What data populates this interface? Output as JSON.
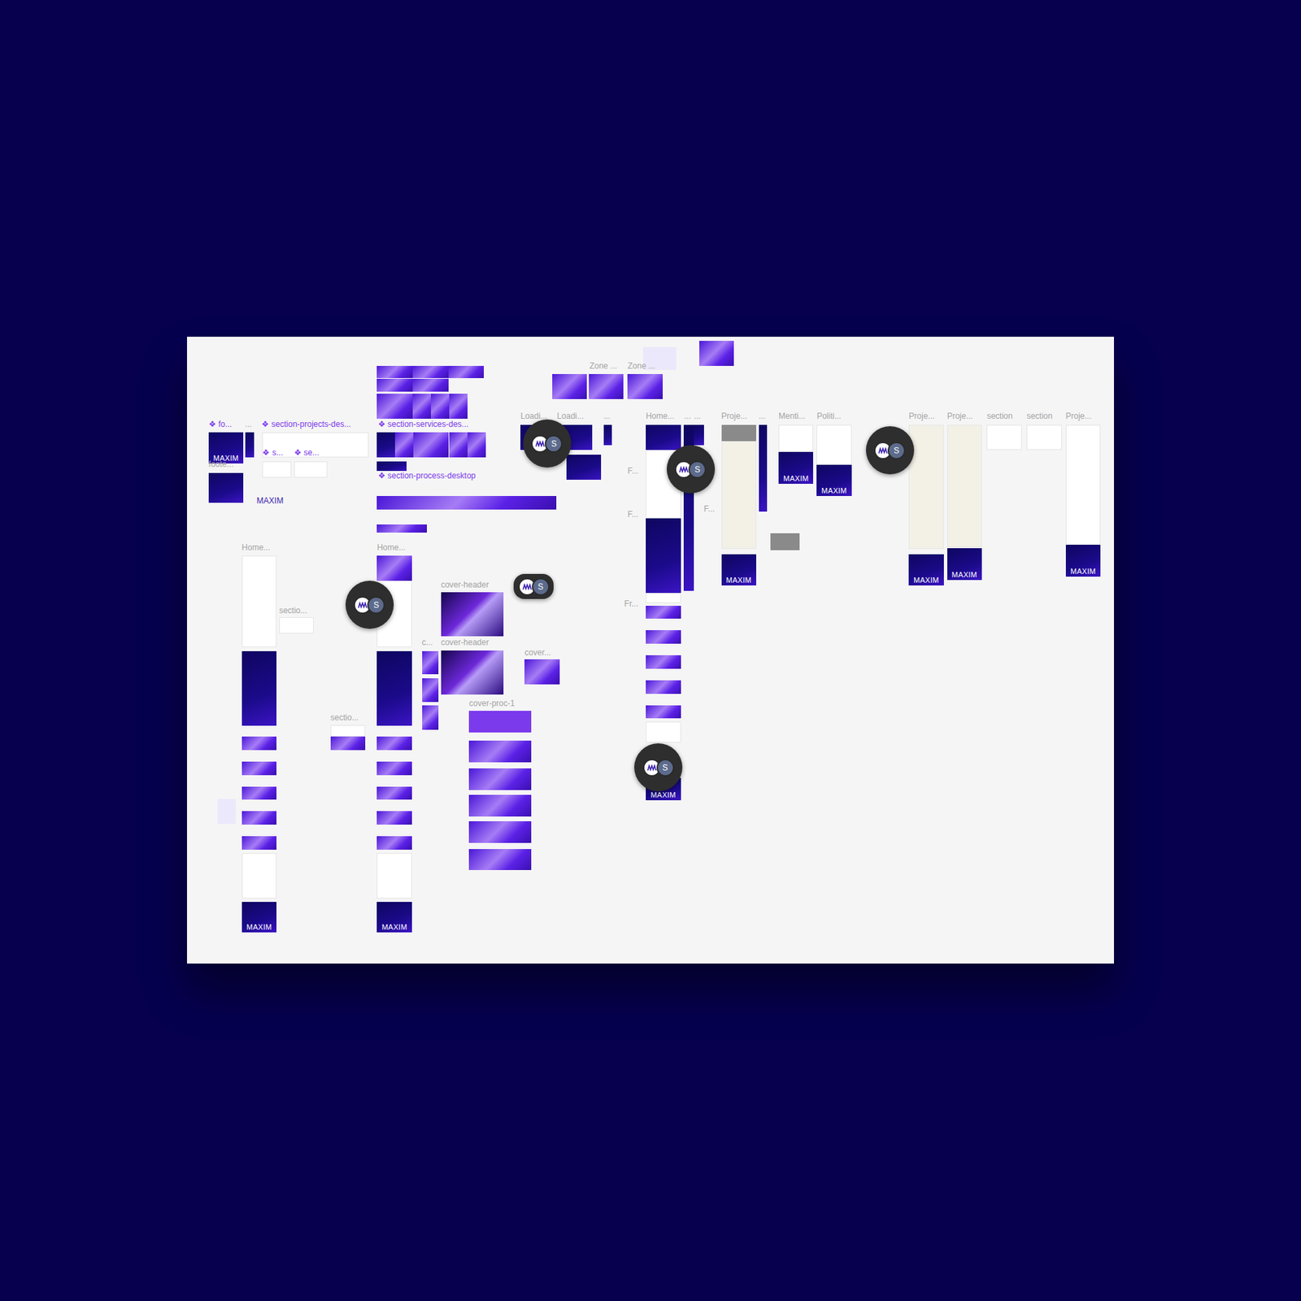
{
  "canvas": {
    "labels": [
      {
        "text": "❖ fo...",
        "kind": "component"
      },
      {
        "text": "...",
        "kind": "frame"
      },
      {
        "text": "❖ section-projects-des...",
        "kind": "component"
      },
      {
        "text": "❖ s...",
        "kind": "component"
      },
      {
        "text": "❖ se...",
        "kind": "component"
      },
      {
        "text": "foote...",
        "kind": "frame"
      },
      {
        "text": "MAXIM",
        "kind": "brand"
      },
      {
        "text": "❖ section-services-des...",
        "kind": "component"
      },
      {
        "text": "❖ section-process-desktop",
        "kind": "component"
      },
      {
        "text": "Zone ...",
        "kind": "frame"
      },
      {
        "text": "Zone ...",
        "kind": "frame"
      },
      {
        "text": "Loadi...",
        "kind": "frame"
      },
      {
        "text": "Loadi...",
        "kind": "frame"
      },
      {
        "text": "...",
        "kind": "frame"
      },
      {
        "text": "Home...",
        "kind": "frame"
      },
      {
        "text": "...",
        "kind": "frame"
      },
      {
        "text": "...",
        "kind": "frame"
      },
      {
        "text": "Proje...",
        "kind": "frame"
      },
      {
        "text": "...",
        "kind": "frame"
      },
      {
        "text": "Menti...",
        "kind": "frame"
      },
      {
        "text": "Politi...",
        "kind": "frame"
      },
      {
        "text": "Proje...",
        "kind": "frame"
      },
      {
        "text": "Proje...",
        "kind": "frame"
      },
      {
        "text": "section",
        "kind": "frame"
      },
      {
        "text": "section",
        "kind": "frame"
      },
      {
        "text": "Proje...",
        "kind": "frame"
      },
      {
        "text": "Home...",
        "kind": "frame"
      },
      {
        "text": "Home...",
        "kind": "frame"
      },
      {
        "text": "sectio...",
        "kind": "frame"
      },
      {
        "text": "cover-header",
        "kind": "frame"
      },
      {
        "text": "cover-header",
        "kind": "frame"
      },
      {
        "text": "c...",
        "kind": "frame"
      },
      {
        "text": "cover...",
        "kind": "frame"
      },
      {
        "text": "cover-proc-1",
        "kind": "frame"
      },
      {
        "text": "sectio...",
        "kind": "frame"
      },
      {
        "text": "F...",
        "kind": "frame"
      },
      {
        "text": "F...",
        "kind": "frame"
      },
      {
        "text": "F...",
        "kind": "frame"
      },
      {
        "text": "Fr...",
        "kind": "frame"
      }
    ],
    "frames": [
      {
        "kind": "gradient"
      },
      {
        "kind": "gradient"
      },
      {
        "kind": "gradient"
      },
      {
        "kind": "gradient"
      },
      {
        "kind": "gradient"
      },
      {
        "kind": "gradient"
      },
      {
        "kind": "gradient"
      },
      {
        "kind": "gradient"
      },
      {
        "kind": "gradient"
      },
      {
        "kind": "gradient"
      },
      {
        "kind": "gradient"
      },
      {
        "kind": "gradient"
      },
      {
        "kind": "gradient"
      },
      {
        "kind": "dark"
      },
      {
        "kind": "gradient"
      },
      {
        "kind": "gradient"
      },
      {
        "kind": "gradient"
      },
      {
        "kind": "gradient"
      },
      {
        "kind": "gradient"
      },
      {
        "kind": "dark"
      },
      {
        "kind": "gradient"
      },
      {
        "kind": "dark",
        "text": "MAXIM"
      },
      {
        "kind": "dark"
      },
      {
        "kind": "dark"
      },
      {
        "kind": "light"
      },
      {
        "kind": "light"
      },
      {
        "kind": "light"
      },
      {
        "kind": "dark"
      },
      {
        "kind": "dark"
      },
      {
        "kind": "dark"
      },
      {
        "kind": "dark"
      },
      {
        "kind": "light"
      },
      {
        "kind": "dark"
      },
      {
        "kind": "gradient"
      },
      {
        "kind": "gradient"
      },
      {
        "kind": "gradient"
      },
      {
        "kind": "gradient"
      },
      {
        "kind": "gradient"
      },
      {
        "kind": "light"
      },
      {
        "kind": "dark",
        "text": "MAXIM"
      },
      {
        "kind": "light"
      },
      {
        "kind": "gradient"
      },
      {
        "kind": "light"
      },
      {
        "kind": "dark"
      },
      {
        "kind": "gradient"
      },
      {
        "kind": "gradient"
      },
      {
        "kind": "gradient"
      },
      {
        "kind": "gradient"
      },
      {
        "kind": "gradient"
      },
      {
        "kind": "light"
      },
      {
        "kind": "dark",
        "text": "MAXIM"
      },
      {
        "kind": "gradient"
      },
      {
        "kind": "gradient"
      },
      {
        "kind": "gradient"
      },
      {
        "kind": "deep"
      },
      {
        "kind": "deep"
      },
      {
        "kind": "gradient"
      },
      {
        "kind": "bright"
      },
      {
        "kind": "gradient"
      },
      {
        "kind": "gradient"
      },
      {
        "kind": "gradient"
      },
      {
        "kind": "gradient"
      },
      {
        "kind": "gradient"
      },
      {
        "kind": "light"
      },
      {
        "kind": "gradient"
      },
      {
        "kind": "dark"
      },
      {
        "kind": "light"
      },
      {
        "kind": "dark"
      },
      {
        "kind": "light"
      },
      {
        "kind": "gradient"
      },
      {
        "kind": "gradient"
      },
      {
        "kind": "gradient"
      },
      {
        "kind": "gradient"
      },
      {
        "kind": "gradient"
      },
      {
        "kind": "light"
      },
      {
        "kind": "dark",
        "text": "MAXIM"
      },
      {
        "kind": "dark"
      },
      {
        "kind": "dark"
      },
      {
        "kind": "grey"
      },
      {
        "kind": "beige"
      },
      {
        "kind": "dark",
        "text": "MAXIM"
      },
      {
        "kind": "dark"
      },
      {
        "kind": "grey"
      },
      {
        "kind": "light"
      },
      {
        "kind": "dark",
        "text": "MAXIM"
      },
      {
        "kind": "light"
      },
      {
        "kind": "dark",
        "text": "MAXIM"
      },
      {
        "kind": "beige"
      },
      {
        "kind": "dark",
        "text": "MAXIM"
      },
      {
        "kind": "beige"
      },
      {
        "kind": "dark",
        "text": "MAXIM"
      },
      {
        "kind": "light"
      },
      {
        "kind": "light"
      },
      {
        "kind": "light"
      },
      {
        "kind": "dark",
        "text": "MAXIM"
      },
      {
        "kind": "lavender"
      },
      {
        "kind": "lavender"
      }
    ],
    "presence": [
      {
        "initial": "S",
        "shape": "circle"
      },
      {
        "initial": "S",
        "shape": "circle"
      },
      {
        "initial": "S",
        "shape": "circle"
      },
      {
        "initial": "S",
        "shape": "circle"
      },
      {
        "initial": "S",
        "shape": "circle"
      },
      {
        "initial": "S",
        "shape": "pill"
      }
    ]
  }
}
